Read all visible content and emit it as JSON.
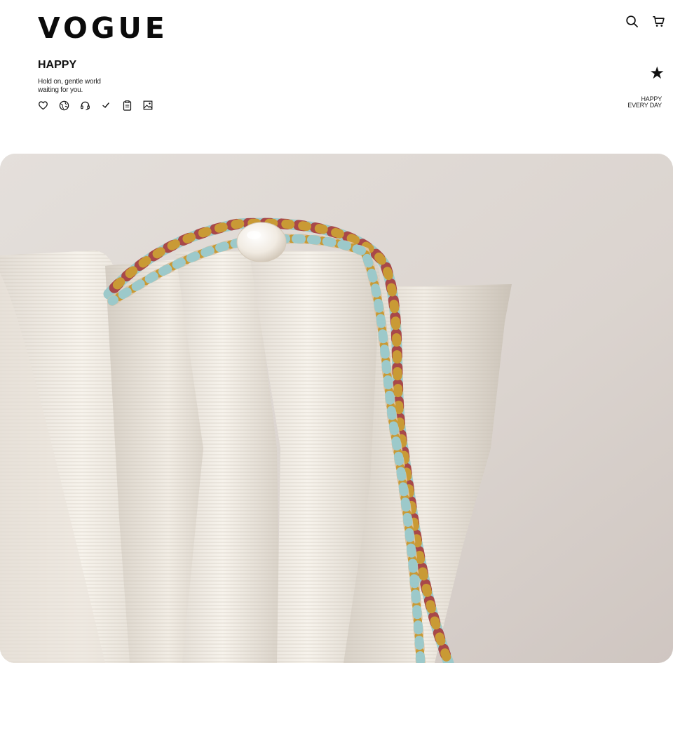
{
  "header": {
    "logo_text": "VOGUE",
    "icons": [
      "search-icon",
      "cart-icon"
    ]
  },
  "intro": {
    "title": "HAPPY",
    "tagline_line1": "Hold on, gentle world",
    "tagline_line2": "waiting for you.",
    "feature_icons": [
      "heart-icon",
      "globe-icon",
      "headset-icon",
      "check-icon",
      "clipboard-icon",
      "image-icon"
    ]
  },
  "side_note": {
    "icon": "star-icon",
    "line1": "HAPPY",
    "line2": "EVERY DAY"
  },
  "hero": {
    "subject": "beaded necklace with pearl draped over white pleated sculpture",
    "colors": {
      "background": "#ddd7d3",
      "fabric": "#f1ece5",
      "turquoise": "#9cc9ca",
      "red_jasper": "#a8484a",
      "gold": "#c99a35",
      "cream": "#dcc3a3"
    }
  }
}
